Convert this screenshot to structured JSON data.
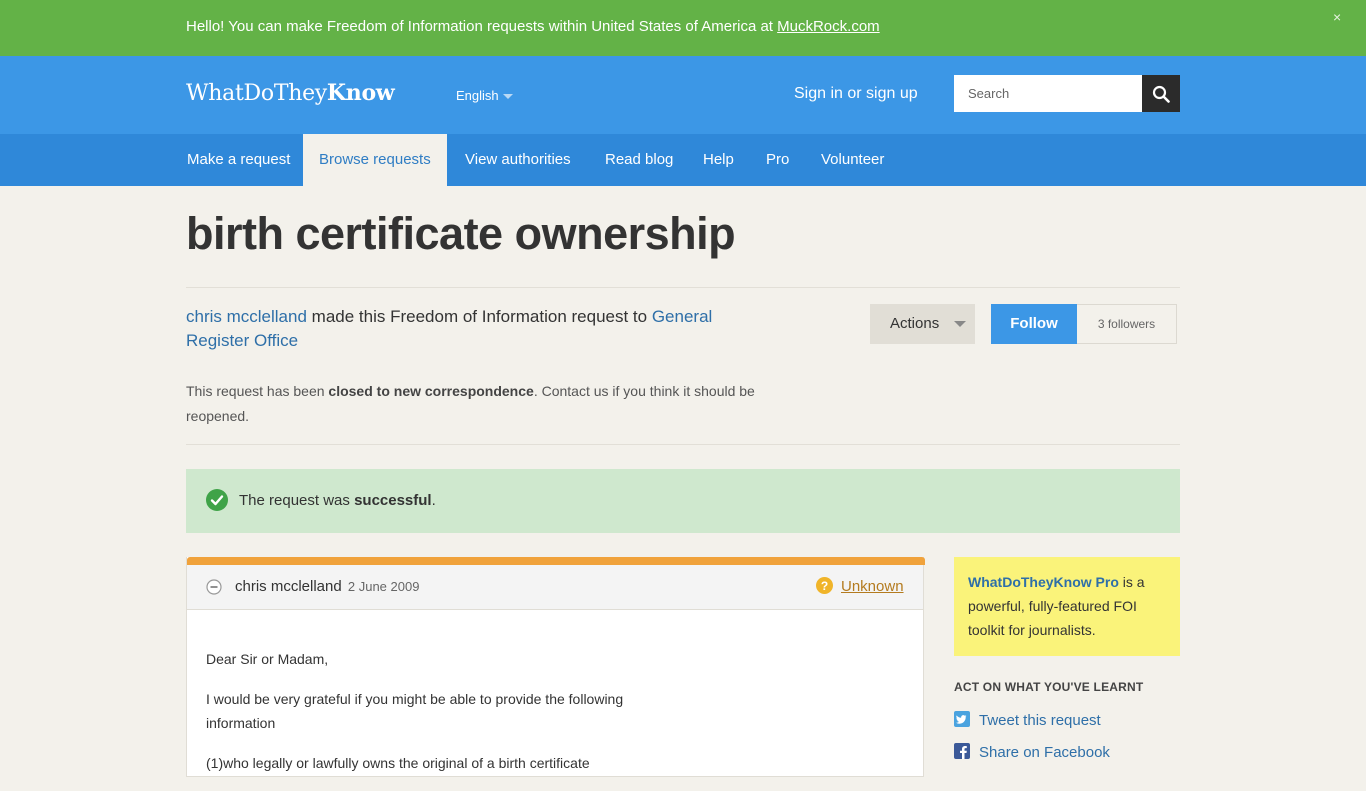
{
  "banner": {
    "text": "Hello! You can make Freedom of Information requests within United States of America at ",
    "link": "MuckRock.com",
    "close": "×"
  },
  "header": {
    "logo_light": "WhatDoThey",
    "logo_bold": "Know",
    "language": "English",
    "signin": "Sign in or sign up",
    "search_placeholder": "Search"
  },
  "nav": {
    "items": [
      "Make a request",
      "Browse requests",
      "View authorities",
      "Read blog",
      "Help",
      "Pro",
      "Volunteer"
    ],
    "active_index": 1
  },
  "request": {
    "title": "birth certificate ownership",
    "requester": "chris mcclelland",
    "intro_middle": " made this Freedom of Information request to ",
    "authority": "General Register Office",
    "closed_pre": "This request has been ",
    "closed_bold": "closed to new correspondence",
    "closed_mid": ". ",
    "closed_link": "Contact us",
    "closed_post": " if you think it should be reopened."
  },
  "actions": {
    "actions_label": "Actions",
    "follow_label": "Follow",
    "followers": "3 followers"
  },
  "status": {
    "pre": "The request was ",
    "bold": "successful",
    "post": "."
  },
  "correspondence": {
    "author": "chris mcclelland",
    "date": "2 June 2009",
    "status": "Unknown",
    "body": [
      "Dear Sir or Madam,",
      "I would be very grateful if you might be able to provide the following information",
      "(1)who legally or lawfully owns the original of a birth certificate"
    ]
  },
  "sidebar": {
    "pro_link": "WhatDoTheyKnow Pro",
    "pro_text": " is a powerful, fully-featured FOI toolkit for journalists.",
    "act_heading": "ACT ON WHAT YOU'VE LEARNT",
    "tweet": "Tweet this request",
    "facebook": "Share on Facebook"
  },
  "colors": {
    "banner": "#63b247",
    "header": "#3c97e6",
    "nav": "#2f88d9",
    "success": "#cfe8ce",
    "accent_orange": "#f0a23b",
    "pro_yellow": "#faf37a"
  }
}
